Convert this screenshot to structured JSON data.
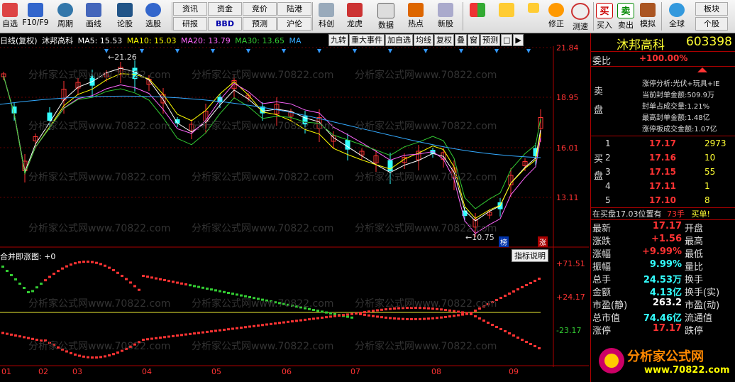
{
  "toolbar": {
    "buttons": [
      "自选",
      "F10/F9",
      "周期",
      "画线",
      "论股",
      "选股"
    ],
    "small_buttons_row1": [
      "资讯",
      "资金",
      "竞价",
      "陆港"
    ],
    "small_buttons_row2": [
      "研报",
      "BBD",
      "预测",
      "沪伦"
    ],
    "buttons2": [
      "科创",
      "龙虎",
      "数据",
      "热点",
      "新股"
    ],
    "buttons3": [
      "修正",
      "测速",
      "买入",
      "卖出",
      "模拟",
      "全球"
    ],
    "right_buttons": [
      "板块",
      "个股"
    ]
  },
  "chart": {
    "period_label": "日线(复权)",
    "stock_name": "沐邦高科",
    "ma5": "MA5: 15.53",
    "ma10": "MA10: 15.03",
    "ma20": "MA20: 13.79",
    "ma30": "MA30: 13.65",
    "ma_more": "MA",
    "tools": [
      "九转",
      "重大事件",
      "加自选",
      "均线",
      "复权",
      "叠",
      "窗",
      "预测"
    ],
    "price_axis": [
      "21.84",
      "18.95",
      "16.01",
      "13.11"
    ],
    "high_label": "21.26",
    "low_label": "10.75",
    "tag_bang": "榜",
    "tag_zhang": "涨",
    "indicator_title": "合并即涨图: +0",
    "indicator_help": "指标说明",
    "indicator_axis": [
      "+71.51",
      "+24.17",
      "-23.17"
    ],
    "dates": [
      "01",
      "02",
      "03",
      "04",
      "05",
      "06",
      "07",
      "08",
      "09"
    ],
    "watermark": "分析家公式网www.70822.com"
  },
  "colors": {
    "ma5": "#ffffff",
    "ma10": "#ffff00",
    "ma20": "#ff66ff",
    "ma30": "#33cc33",
    "ma_long": "#33aaff",
    "up": "#ff3333",
    "down": "#33ffff"
  },
  "panel": {
    "name": "沐邦高科",
    "code": "603398",
    "weibi_label": "委比",
    "weibi": "+100.00%",
    "sell_label": "卖盘",
    "buy_label": "买盘",
    "info": [
      "涨停分析:光伏+玩具+IE",
      "当前封单金额:509.9万",
      "封单占成交量:1.21%",
      "最高封单金额:1.48亿",
      "涨停板成交金额:1.07亿"
    ],
    "bids": [
      {
        "n": "1",
        "p": "17.17",
        "v": "2973"
      },
      {
        "n": "2",
        "p": "17.16",
        "v": "10"
      },
      {
        "n": "3",
        "p": "17.15",
        "v": "55"
      },
      {
        "n": "4",
        "p": "17.11",
        "v": "1"
      },
      {
        "n": "5",
        "p": "17.10",
        "v": "8"
      }
    ],
    "status_line": "在买盘17.03位置有",
    "status_hands": "73手",
    "status_buy": "买单!",
    "quotes": [
      {
        "l": "最新",
        "v": "17.17",
        "c": "red",
        "r": "开盘"
      },
      {
        "l": "涨跌",
        "v": "+1.56",
        "c": "red",
        "r": "最高"
      },
      {
        "l": "涨幅",
        "v": "+9.99%",
        "c": "red",
        "r": "最低"
      },
      {
        "l": "振幅",
        "v": "9.99%",
        "c": "cyan",
        "r": "量比"
      },
      {
        "l": "总手",
        "v": "24.53万",
        "c": "cyan",
        "r": "换手"
      },
      {
        "l": "金额",
        "v": "4.13亿",
        "c": "cyan",
        "r": "换手(实)"
      },
      {
        "l": "市盈(静)",
        "v": "263.2",
        "c": "white",
        "r": "市盈(动)"
      },
      {
        "l": "总市值",
        "v": "74.46亿",
        "c": "cyan",
        "r": "流通值"
      },
      {
        "l": "涨停",
        "v": "17.17",
        "c": "red",
        "r": "跌停"
      }
    ],
    "logo_text": "分析家公式网",
    "logo_url": "www.70822.com"
  }
}
